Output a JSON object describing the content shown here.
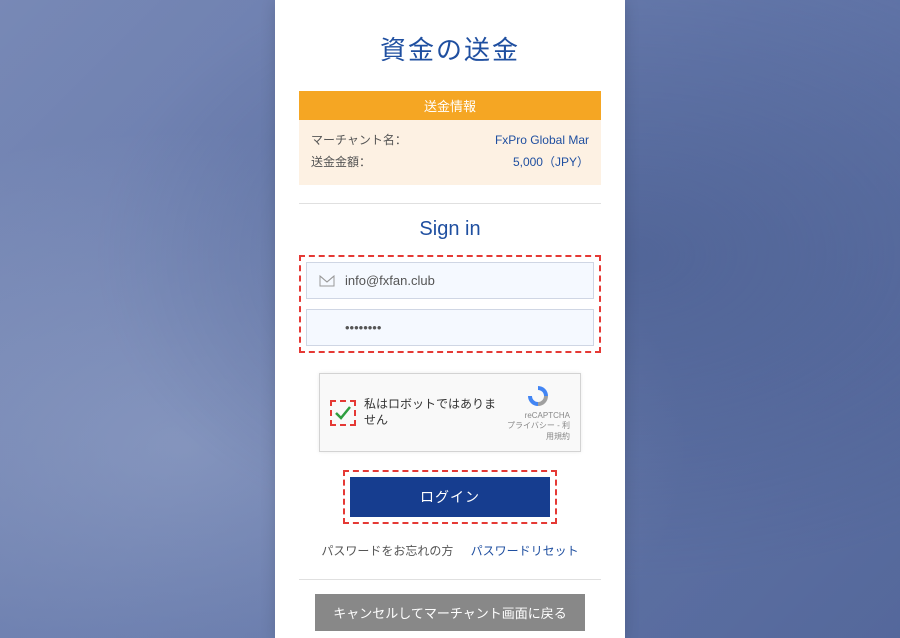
{
  "page_title": "資金の送金",
  "info": {
    "header": "送金情報",
    "merchant_label": "マーチャント名：",
    "merchant_value": "FxPro Global Mar",
    "amount_label": "送金金額：",
    "amount_value": "5,000（JPY）"
  },
  "signin": {
    "title": "Sign in",
    "email": "info@fxfan.club",
    "password": "••••••••"
  },
  "captcha": {
    "text": "私はロボットではありません",
    "brand": "reCAPTCHA",
    "terms": "プライバシー - 利用規約"
  },
  "login_label": "ログイン",
  "forgot_label": "パスワードをお忘れの方",
  "reset_link": "パスワードリセット",
  "cancel_label": "キャンセルしてマーチャント画面に戻る"
}
